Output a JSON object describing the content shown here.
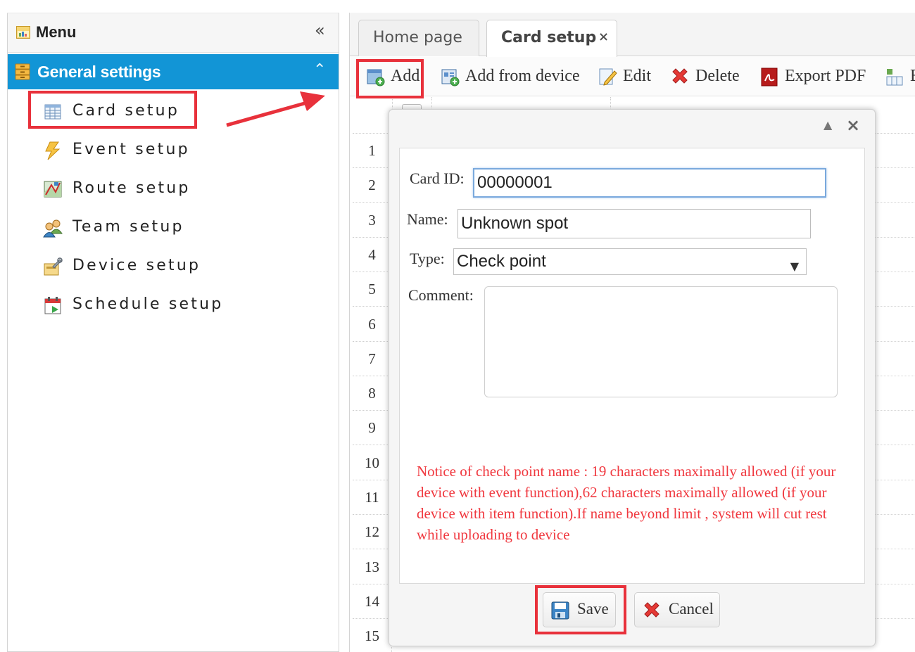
{
  "sidebar": {
    "title": "Menu",
    "group": "General settings",
    "items": [
      {
        "label": "Card setup"
      },
      {
        "label": "Event setup"
      },
      {
        "label": "Route setup"
      },
      {
        "label": "Team setup"
      },
      {
        "label": "Device setup"
      },
      {
        "label": "Schedule setup"
      }
    ]
  },
  "tabs": [
    {
      "label": "Home page"
    },
    {
      "label": "Card setup",
      "active": true,
      "close_icon": "×"
    }
  ],
  "toolbar": {
    "buttons": [
      {
        "label": "Add",
        "icon": "add-icon"
      },
      {
        "label": "Add from device",
        "icon": "add-from-device-icon"
      },
      {
        "label": "Edit",
        "icon": "edit-icon"
      },
      {
        "label": "Delete",
        "icon": "delete-icon"
      },
      {
        "label": "Export PDF",
        "icon": "pdf-icon"
      },
      {
        "label": "E",
        "icon": "export-excel-icon"
      }
    ]
  },
  "grid": {
    "row_numbers": [
      "1",
      "2",
      "3",
      "4",
      "5",
      "6",
      "7",
      "8",
      "9",
      "10",
      "11",
      "12",
      "13",
      "14",
      "15"
    ]
  },
  "dialog": {
    "card_id_label": "Card ID:",
    "card_id_value": "00000001",
    "name_label": "Name:",
    "name_value": "Unknown spot",
    "type_label": "Type:",
    "type_value": "Check point",
    "comment_label": "Comment:",
    "comment_value": "",
    "notice": "Notice of check point name : 19 characters maximally allowed (if your device with event function),62 characters maximally allowed (if your device with item function).If name beyond limit , system will cut rest while uploading to device",
    "save_label": "Save",
    "cancel_label": "Cancel"
  },
  "colors": {
    "accent": "#1295d6",
    "highlight": "#e8313b",
    "notice": "#f0383f"
  }
}
